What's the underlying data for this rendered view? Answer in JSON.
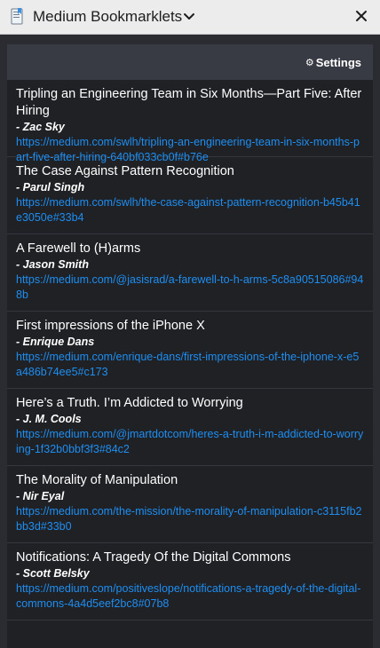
{
  "window": {
    "title": "Medium Bookmarklets",
    "app_icon": "bookmark-page-icon",
    "dropdown_icon": "chevron-down-icon",
    "close_icon": "close-icon"
  },
  "panel": {
    "settings_icon": "gear-icon",
    "settings_label": "Settings"
  },
  "bookmarks": [
    {
      "title": "Tripling an Engineering Team in Six Months—Part Five: After Hiring",
      "author": "- Zac Sky",
      "url": "https://medium.com/swlh/tripling-an-engineering-team-in-six-months-part-five-after-hiring-640bf033cb0f#b76e"
    },
    {
      "title": "The Case Against Pattern Recognition",
      "author": "- Parul Singh",
      "url": "https://medium.com/swlh/the-case-against-pattern-recognition-b45b41e3050e#33b4"
    },
    {
      "title": "A Farewell to (H)arms",
      "author": "- Jason Smith",
      "url": "https://medium.com/@jasisrad/a-farewell-to-h-arms-5c8a90515086#948b"
    },
    {
      "title": "First impressions of the iPhone X",
      "author": "- Enrique Dans",
      "url": "https://medium.com/enrique-dans/first-impressions-of-the-iphone-x-e5a486b74ee5#c173"
    },
    {
      "title": "Here’s a Truth. I’m Addicted to Worrying",
      "author": "- J. M. Cools",
      "url": "https://medium.com/@jmartdotcom/heres-a-truth-i-m-addicted-to-worrying-1f32b0bbf3f3#84c2"
    },
    {
      "title": "The Morality of Manipulation",
      "author": "- Nir Eyal",
      "url": "https://medium.com/the-mission/the-morality-of-manipulation-c3115fb2bb3d#33b0"
    },
    {
      "title": "Notifications: A Tragedy Of the Digital Commons",
      "author": "- Scott Belsky",
      "url": "https://medium.com/positiveslope/notifications-a-tragedy-of-the-digital-commons-4a4d5eef2bc8#07b8"
    }
  ]
}
